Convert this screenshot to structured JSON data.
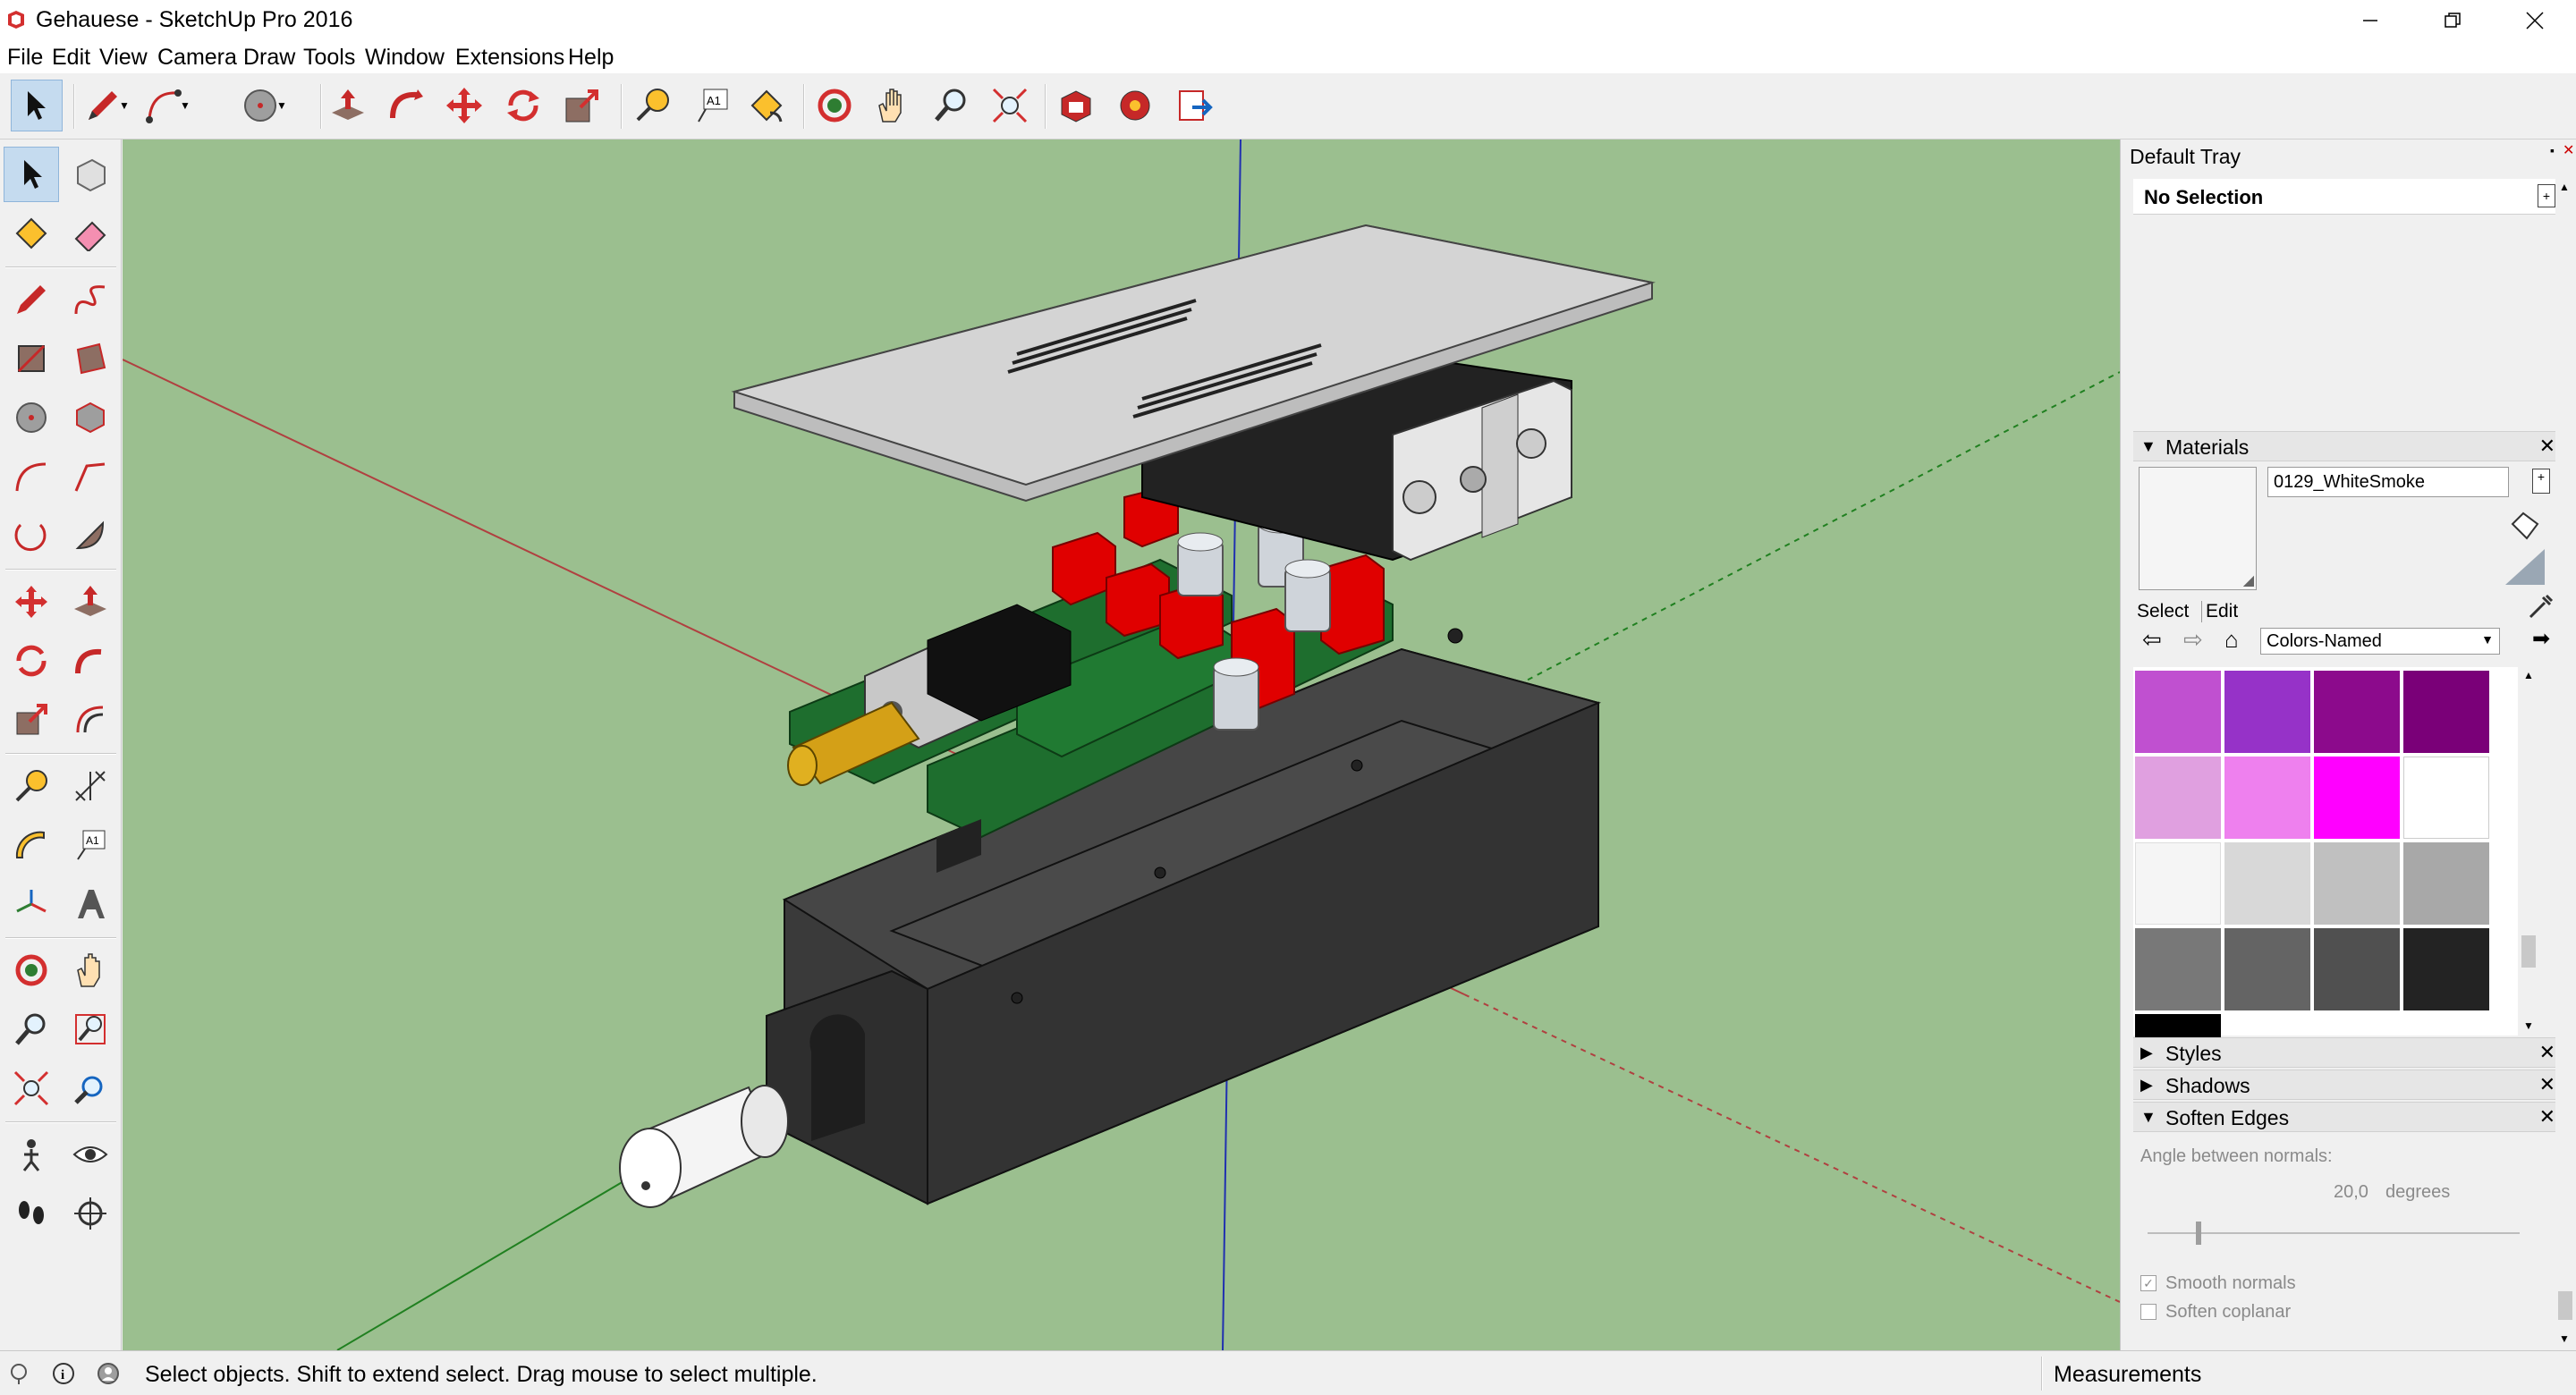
{
  "window": {
    "title": "Gehauese - SketchUp Pro 2016",
    "controls": [
      "minimize",
      "restore",
      "close"
    ]
  },
  "menu": [
    "File",
    "Edit",
    "View",
    "Camera",
    "Draw",
    "Tools",
    "Window",
    "Extensions",
    "Help"
  ],
  "toolbar_icons": [
    "select-icon",
    "pencil-icon",
    "arc-icon",
    "circle-icon",
    "push-pull-icon",
    "follow-me-icon",
    "move-icon",
    "rotate-icon",
    "scale-icon",
    "tape-measure-icon",
    "text-icon",
    "paint-bucket-icon",
    "orbit-icon",
    "pan-icon",
    "zoom-icon",
    "zoom-extents-icon",
    "warehouse-icon",
    "extension-warehouse-icon",
    "send-to-layout-icon"
  ],
  "left_toolbar_icons": [
    "select-icon",
    "make-component-icon",
    "paint-bucket-icon",
    "eraser-icon",
    "line-icon",
    "freehand-icon",
    "rectangle-icon",
    "rotated-rectangle-icon",
    "circle-icon",
    "polygon-icon",
    "arc-icon",
    "two-point-arc-icon",
    "three-point-arc-icon",
    "pie-icon",
    "move-icon",
    "push-pull-icon",
    "rotate-icon",
    "follow-me-icon",
    "scale-icon",
    "offset-icon",
    "tape-measure-icon",
    "dimension-icon",
    "protractor-icon",
    "text-icon",
    "axes-icon",
    "3d-text-icon",
    "orbit-icon",
    "pan-icon",
    "zoom-icon",
    "zoom-window-icon",
    "zoom-extents-icon",
    "previous-view-icon",
    "position-camera-icon",
    "look-around-icon",
    "walk-icon",
    "section-plane-icon"
  ],
  "tray": {
    "title": "Default Tray",
    "entity_info": "No Selection",
    "materials": {
      "header": "Materials",
      "material_name": "0129_WhiteSmoke",
      "tabs": [
        "Select",
        "Edit"
      ],
      "library": "Colors-Named",
      "swatches": [
        "#c050d0",
        "#9632c8",
        "#8c0a8c",
        "#7a0078",
        "#e0a0e0",
        "#ee80ee",
        "#ff00ff",
        "#ffffff",
        "#f5f5f5",
        "#d8d8d8",
        "#c0c0c0",
        "#a8a8a8",
        "#787878",
        "#646464",
        "#505050",
        "#232323",
        "#000000"
      ]
    },
    "styles": "Styles",
    "shadows": "Shadows",
    "soften": {
      "header": "Soften Edges",
      "angle_label": "Angle between normals:",
      "angle_value": "20,0",
      "angle_unit": "degrees",
      "smooth_normals": "Smooth normals",
      "soften_coplanar": "Soften coplanar",
      "smooth_checked": true,
      "coplanar_checked": false
    }
  },
  "status": {
    "text": "Select objects. Shift to extend select. Drag mouse to select multiple.",
    "measurements": "Measurements"
  },
  "colors": {
    "viewport_bg": "#9bbf8f",
    "red_axis": "#b04040",
    "green_axis": "#208020",
    "blue_axis": "#2030b0",
    "pcb": "#1e6e2e",
    "capacitor_red": "#e00000",
    "enclosure": "#3a3a3a",
    "lid": "#d4d4d4"
  }
}
